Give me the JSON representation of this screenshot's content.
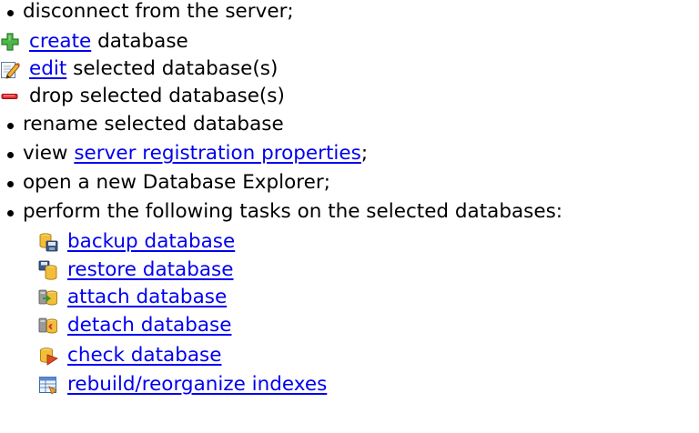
{
  "items": [
    {
      "icon": "bullet",
      "parts": [
        {
          "text": "disconnect from the server;",
          "link": false
        }
      ]
    },
    {
      "icon": "plus-icon",
      "parts": [
        {
          "text": "create",
          "link": true
        },
        {
          "text": " database",
          "link": false
        }
      ]
    },
    {
      "icon": "edit-pencil-icon",
      "parts": [
        {
          "text": "edit",
          "link": true
        },
        {
          "text": " selected database(s)",
          "link": false
        }
      ]
    },
    {
      "icon": "minus-icon",
      "parts": [
        {
          "text": "drop selected database(s)",
          "link": false
        }
      ]
    },
    {
      "icon": "bullet",
      "parts": [
        {
          "text": "rename selected database",
          "link": false
        }
      ]
    },
    {
      "icon": "bullet",
      "parts": [
        {
          "text": "view ",
          "link": false
        },
        {
          "text": "server registration properties",
          "link": true
        },
        {
          "text": ";",
          "link": false
        }
      ]
    },
    {
      "icon": "bullet",
      "parts": [
        {
          "text": "open a new Database Explorer;",
          "link": false
        }
      ]
    },
    {
      "icon": "bullet",
      "parts": [
        {
          "text": "perform the following tasks on the selected databases:",
          "link": false
        }
      ]
    }
  ],
  "tasks": [
    {
      "icon": "backup-database-icon",
      "label": "backup database"
    },
    {
      "icon": "restore-database-icon",
      "label": "restore database"
    },
    {
      "icon": "attach-database-icon",
      "label": "attach database"
    },
    {
      "icon": "detach-database-icon",
      "label": "detach database"
    },
    {
      "icon": "check-database-icon",
      "label": "check database"
    },
    {
      "icon": "rebuild-indexes-icon",
      "label": "rebuild/reorganize indexes"
    }
  ],
  "colors": {
    "link": "#0000ee",
    "text": "#000000",
    "plus": "#3aa33a",
    "minus": "#e02020"
  }
}
